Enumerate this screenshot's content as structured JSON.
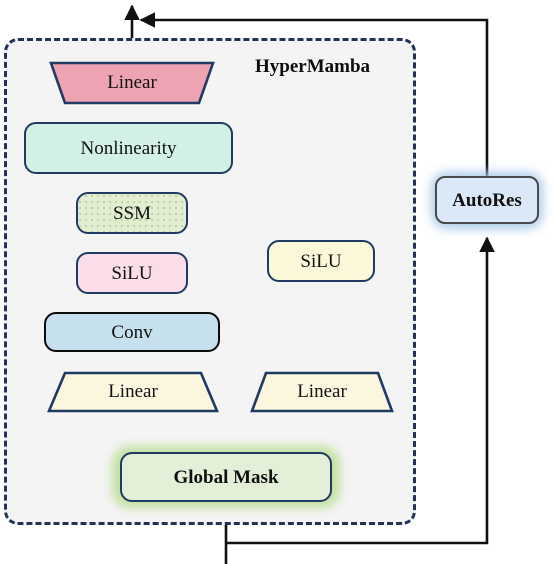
{
  "diagram": {
    "title": "HyperMamba architecture block diagram",
    "module": {
      "label": "HyperMamba",
      "border_color": "#223355",
      "fill_color": "#f4f4f4",
      "border_style": "dashed"
    },
    "nodes": {
      "linear_out": {
        "label": "Linear",
        "shape": "trapezoid-down",
        "fill": "#eda3b2",
        "stroke": "#1f3a63",
        "font_size": 19
      },
      "nonlinearity": {
        "label": "Nonlinearity",
        "shape": "rounded-rect",
        "fill": "#d3f0e4",
        "stroke": "#1f3a63",
        "font_size": 19
      },
      "ssm": {
        "label": "SSM",
        "shape": "rounded-rect",
        "fill": "#e2eed0",
        "stroke": "#1f3a63",
        "font_size": 19,
        "texture": "dots"
      },
      "silu_left": {
        "label": "SiLU",
        "shape": "rounded-rect",
        "fill": "#fbdde9",
        "stroke": "#1f3a63",
        "font_size": 19
      },
      "conv": {
        "label": "Conv",
        "shape": "rounded-rect",
        "fill": "#c7e0ee",
        "stroke": "#0a0a0a",
        "font_size": 19
      },
      "linear_left": {
        "label": "Linear",
        "shape": "trapezoid-up",
        "fill": "#fbf6dd",
        "stroke": "#1f3a63",
        "font_size": 19
      },
      "linear_right": {
        "label": "Linear",
        "shape": "trapezoid-up",
        "fill": "#fbf6dd",
        "stroke": "#1f3a63",
        "font_size": 19
      },
      "silu_right": {
        "label": "SiLU",
        "shape": "rounded-rect",
        "fill": "#fbf8d9",
        "stroke": "#1f3a63",
        "font_size": 19
      },
      "global_mask": {
        "label": "Global Mask",
        "shape": "rounded-rect",
        "fill": "#e4efd7",
        "stroke": "#1f3a63",
        "font_size": 19,
        "bold": true,
        "glow": "#bfe09a"
      },
      "autores": {
        "label": "AutoRes",
        "shape": "rounded-rect",
        "fill": "#dae8f7",
        "stroke": "#4a4a4a",
        "font_size": 19,
        "bold": true,
        "glow": "#a8cbe8"
      }
    },
    "edges": [
      {
        "from": "linear_out",
        "to": "output",
        "style": "solid-arrow"
      },
      {
        "from": "nonlinearity",
        "to": "linear_out",
        "style": "solid-arrow"
      },
      {
        "from": "ssm",
        "to": "nonlinearity",
        "style": "solid-arrow"
      },
      {
        "from": "silu_left",
        "to": "ssm",
        "style": "solid-arrow"
      },
      {
        "from": "conv",
        "to": "silu_left",
        "style": "solid-arrow"
      },
      {
        "from": "linear_left",
        "to": "conv",
        "style": "solid-arrow"
      },
      {
        "from": "global_mask",
        "to": "linear_left",
        "style": "solid-arrow"
      },
      {
        "from": "global_mask",
        "to": "linear_right",
        "style": "solid-arrow"
      },
      {
        "from": "linear_right",
        "to": "silu_right",
        "style": "solid-arrow"
      },
      {
        "from": "silu_right",
        "to": "nonlinearity",
        "style": "solid-arrow"
      },
      {
        "from": "input",
        "to": "global_mask",
        "style": "solid-line"
      },
      {
        "from": "input",
        "to": "autores",
        "style": "solid-arrow"
      },
      {
        "from": "autores",
        "to": "output",
        "style": "solid-arrow"
      }
    ],
    "edge_color": "#111111"
  }
}
